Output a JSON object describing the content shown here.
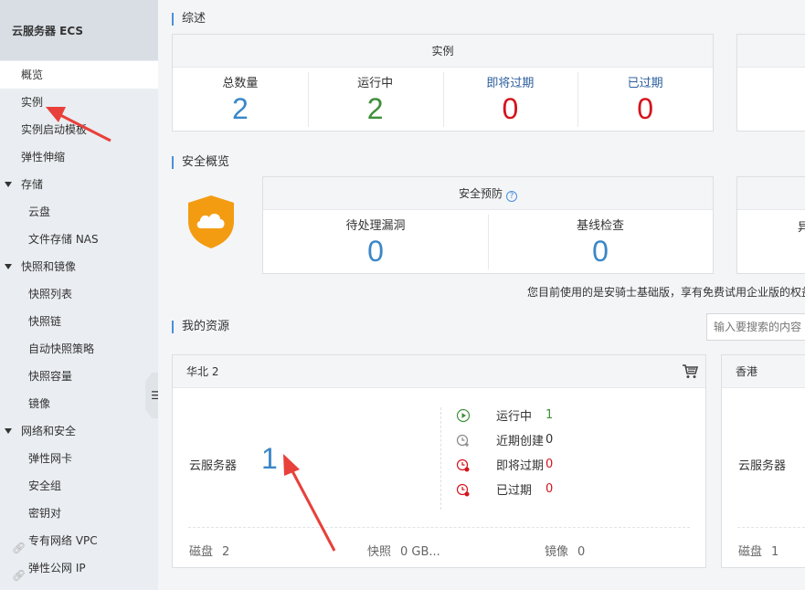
{
  "sidebar": {
    "title": "云服务器 ECS",
    "items": [
      {
        "label": "概览",
        "level": 1,
        "active": true
      },
      {
        "label": "实例",
        "level": 1
      },
      {
        "label": "实例启动模板",
        "level": 1
      },
      {
        "label": "弹性伸缩",
        "level": 1
      },
      {
        "label": "存储",
        "group": true
      },
      {
        "label": "云盘",
        "level": 2
      },
      {
        "label": "文件存储 NAS",
        "level": 2
      },
      {
        "label": "快照和镜像",
        "group": true
      },
      {
        "label": "快照列表",
        "level": 2
      },
      {
        "label": "快照链",
        "level": 2
      },
      {
        "label": "自动快照策略",
        "level": 2
      },
      {
        "label": "快照容量",
        "level": 2
      },
      {
        "label": "镜像",
        "level": 2
      },
      {
        "label": "网络和安全",
        "group": true
      },
      {
        "label": "弹性网卡",
        "level": 2
      },
      {
        "label": "安全组",
        "level": 2
      },
      {
        "label": "密钥对",
        "level": 2
      },
      {
        "label": "专有网络 VPC",
        "external": true
      },
      {
        "label": "弹性公网 IP",
        "external": true
      }
    ],
    "collapse_icon": "menu-icon"
  },
  "overview": {
    "title": "综述",
    "instances": {
      "header": "实例",
      "stats": [
        {
          "label": "总数量",
          "value": "2",
          "color": "#3a87c8"
        },
        {
          "label": "运行中",
          "value": "2",
          "color": "#3f8f3a"
        },
        {
          "label": "即将过期",
          "value": "0",
          "color": "#d4141d"
        },
        {
          "label": "已过期",
          "value": "0",
          "color": "#d4141d"
        }
      ]
    }
  },
  "security": {
    "title": "安全概览",
    "header": "安全预防",
    "help_icon": "?",
    "stats": [
      {
        "label": "待处理漏洞",
        "value": "0"
      },
      {
        "label": "基线检查",
        "value": "0"
      }
    ],
    "right_partial_label": "异",
    "note": "您目前使用的是安骑士基础版，享有免费试用企业版的权益"
  },
  "resources": {
    "title": "我的资源",
    "search_placeholder": "输入要搜索的内容",
    "regions": [
      {
        "name": "华北 2",
        "ecs_label": "云服务器",
        "ecs_count": "1",
        "status": [
          {
            "label": "运行中",
            "value": "1",
            "icon": "play-icon",
            "color": "#3f8f3a"
          },
          {
            "label": "近期创建",
            "value": "0",
            "icon": "clock-plus-icon",
            "color": "#333333"
          },
          {
            "label": "即将过期",
            "value": "0",
            "icon": "clock-alert-icon",
            "color": "#d4141d"
          },
          {
            "label": "已过期",
            "value": "0",
            "icon": "clock-expired-icon",
            "color": "#d4141d"
          }
        ],
        "footer": [
          {
            "label": "磁盘",
            "value": "2"
          },
          {
            "label": "快照",
            "value": "0 GB..."
          },
          {
            "label": "镜像",
            "value": "0"
          }
        ]
      },
      {
        "name": "香港",
        "ecs_label": "云服务器",
        "footer": [
          {
            "label": "磁盘",
            "value": "1"
          }
        ]
      }
    ]
  },
  "colors": {
    "accent": "#4a90d9",
    "arrow": "#e8403a"
  }
}
